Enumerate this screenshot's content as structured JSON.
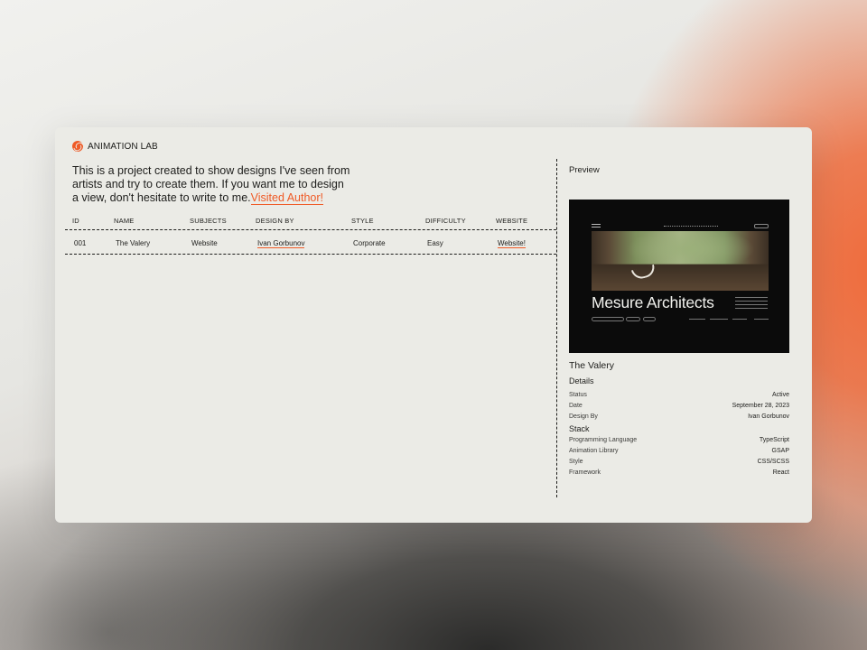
{
  "brand": {
    "name": "ANIMATION LAB",
    "accent": "#ef5a26"
  },
  "intro": {
    "text": "This is a project created to show designs I've seen from artists and try to create them. If you want me to design a view, don't hesitate to write to me.",
    "link": "Visited Author!"
  },
  "table": {
    "headers": [
      "ID",
      "NAME",
      "SUBJECTS",
      "DESIGN BY",
      "STYLE",
      "DIFFICULTY",
      "WEBSITE"
    ],
    "rows": [
      [
        "001",
        "The Valery",
        "Website",
        "Ivan Gorbunov",
        "Corporate",
        "Easy",
        "Website!"
      ]
    ]
  },
  "preview": {
    "label": "Preview",
    "image_title": "Mesure Architects"
  },
  "project": {
    "name": "The Valery",
    "details_title": "Details",
    "details": [
      {
        "key": "Status",
        "value": "Active"
      },
      {
        "key": "Date",
        "value": "September 28, 2023"
      },
      {
        "key": "Design By",
        "value": "Ivan Gorbunov"
      }
    ],
    "stack_title": "Stack",
    "stack": [
      {
        "key": "Programming Language",
        "value": "TypeScript"
      },
      {
        "key": "Animation Library",
        "value": "GSAP"
      },
      {
        "key": "Style",
        "value": "CSS/SCSS"
      },
      {
        "key": "Framework",
        "value": "React"
      }
    ]
  }
}
